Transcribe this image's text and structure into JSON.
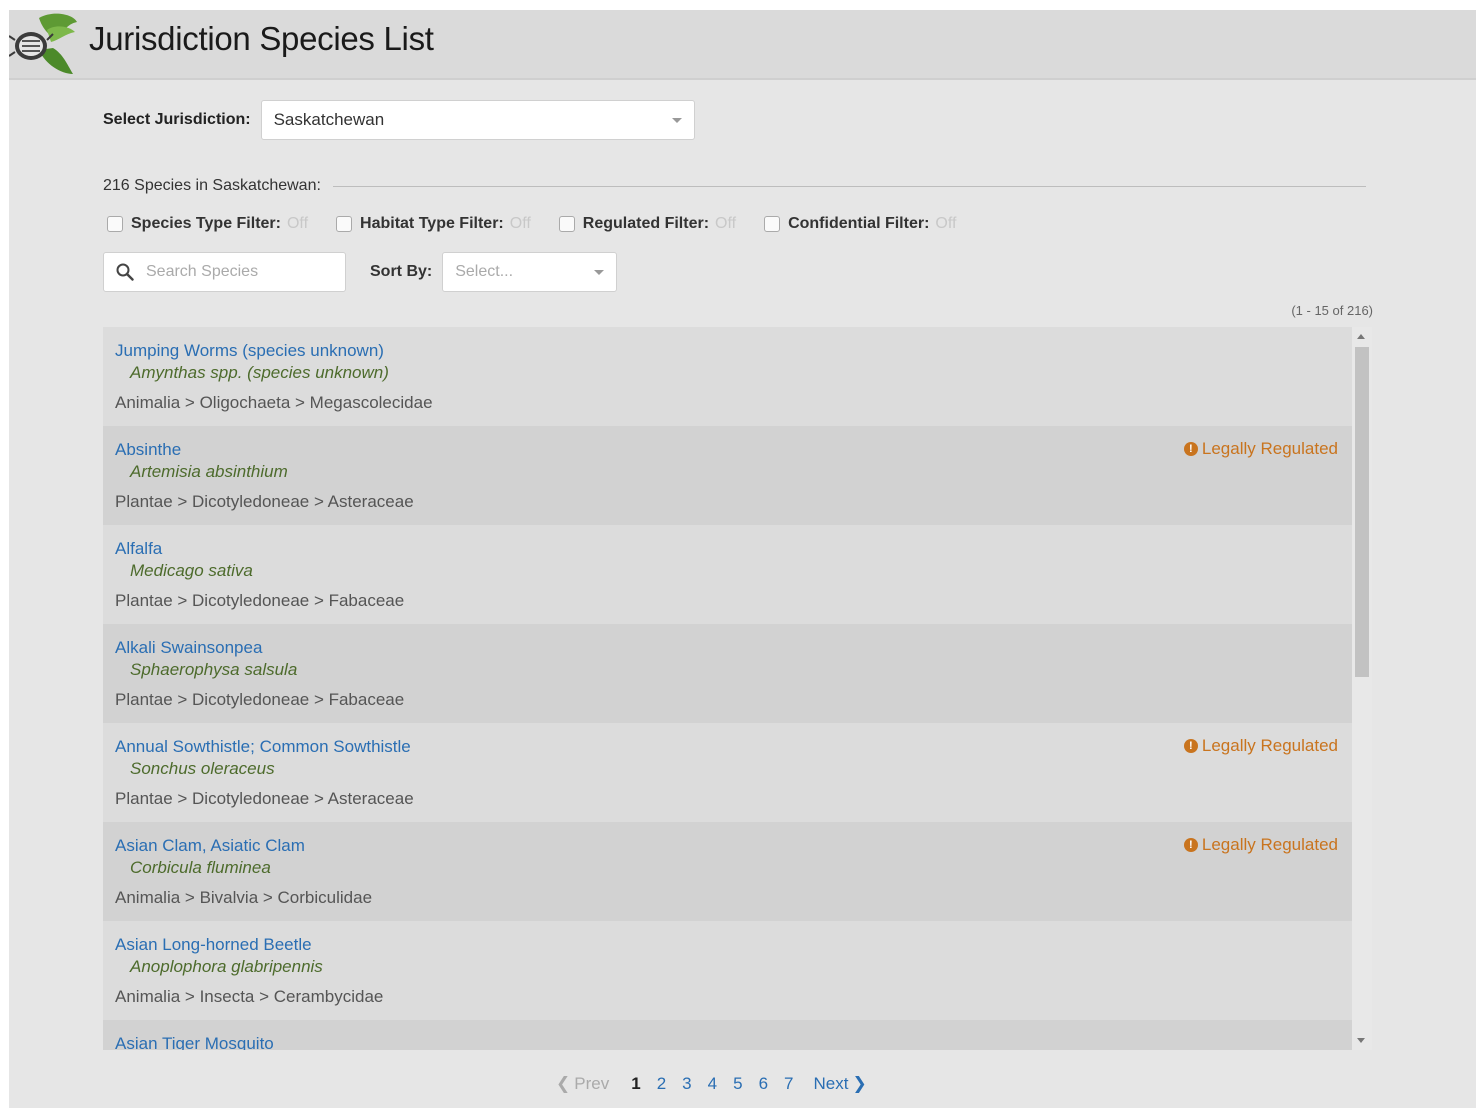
{
  "header": {
    "title": "Jurisdiction Species List",
    "logo_icon": "leaf-bug-logo"
  },
  "jurisdiction": {
    "label": "Select Jurisdiction:",
    "value": "Saskatchewan"
  },
  "summary": {
    "count_text": "216 Species in Saskatchewan:"
  },
  "filters": [
    {
      "label": "Species Type Filter:",
      "state": "Off"
    },
    {
      "label": "Habitat Type Filter:",
      "state": "Off"
    },
    {
      "label": "Regulated Filter:",
      "state": "Off"
    },
    {
      "label": "Confidential Filter:",
      "state": "Off"
    }
  ],
  "search": {
    "placeholder": "Search Species",
    "value": ""
  },
  "sort": {
    "label": "Sort By:",
    "placeholder": "Select..."
  },
  "range": "(1 - 15 of 216)",
  "regulated_label": "Legally Regulated",
  "species": [
    {
      "common": "Jumping Worms (species unknown)",
      "scientific": "Amynthas spp. (species unknown)",
      "taxonomy": "Animalia > Oligochaeta > Megascolecidae",
      "regulated": false
    },
    {
      "common": "Absinthe",
      "scientific": "Artemisia absinthium",
      "taxonomy": "Plantae > Dicotyledoneae > Asteraceae",
      "regulated": true
    },
    {
      "common": "Alfalfa",
      "scientific": "Medicago sativa",
      "taxonomy": "Plantae > Dicotyledoneae > Fabaceae",
      "regulated": false
    },
    {
      "common": "Alkali Swainsonpea",
      "scientific": "Sphaerophysa salsula",
      "taxonomy": "Plantae > Dicotyledoneae > Fabaceae",
      "regulated": false
    },
    {
      "common": "Annual Sowthistle; Common Sowthistle",
      "scientific": "Sonchus oleraceus",
      "taxonomy": "Plantae > Dicotyledoneae > Asteraceae",
      "regulated": true
    },
    {
      "common": "Asian Clam, Asiatic Clam",
      "scientific": "Corbicula fluminea",
      "taxonomy": "Animalia > Bivalvia > Corbiculidae",
      "regulated": true
    },
    {
      "common": "Asian Long-horned Beetle",
      "scientific": "Anoplophora glabripennis",
      "taxonomy": "Animalia > Insecta > Cerambycidae",
      "regulated": false
    },
    {
      "common": "Asian Tiger Mosquito",
      "scientific": "",
      "taxonomy": "",
      "regulated": false
    }
  ],
  "pagination": {
    "prev": "Prev",
    "next": "Next",
    "pages": [
      "1",
      "2",
      "3",
      "4",
      "5",
      "6",
      "7"
    ],
    "current": "1"
  },
  "colors": {
    "link": "#2a6eb3",
    "scientific": "#4d6b2c",
    "regulated": "#c9741e"
  }
}
